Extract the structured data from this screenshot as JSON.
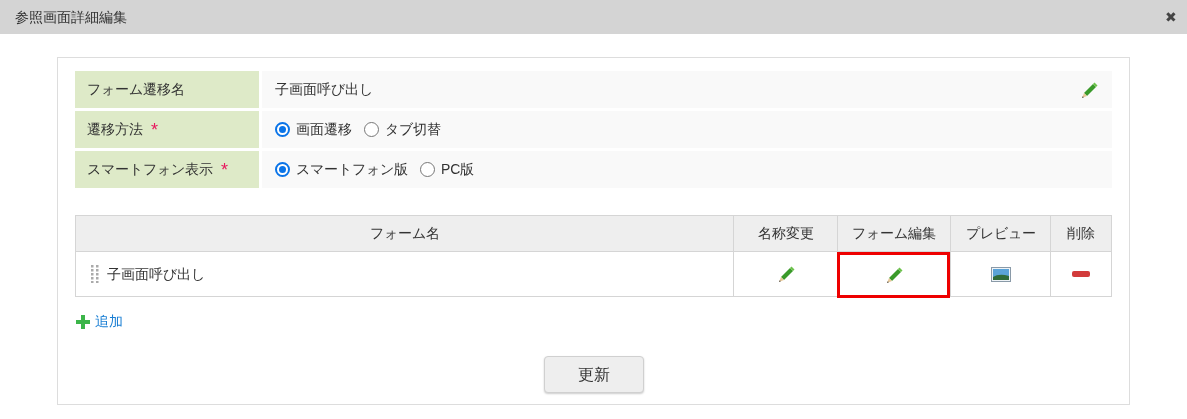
{
  "window": {
    "title": "参照画面詳細編集",
    "close": "✖"
  },
  "form": [
    {
      "kind": "text",
      "label": "フォーム遷移名",
      "required": false,
      "value": "子画面呼び出し"
    },
    {
      "kind": "radio",
      "label": "遷移方法",
      "required": true,
      "options": [
        {
          "label": "画面遷移",
          "selected": true
        },
        {
          "label": "タブ切替",
          "selected": false
        }
      ]
    },
    {
      "kind": "radio",
      "label": "スマートフォン表示",
      "required": true,
      "options": [
        {
          "label": "スマートフォン版",
          "selected": true
        },
        {
          "label": "PC版",
          "selected": false
        }
      ]
    }
  ],
  "required_mark": "*",
  "table": {
    "columns": [
      "フォーム名",
      "名称変更",
      "フォーム編集",
      "プレビュー",
      "削除"
    ],
    "rows": [
      {
        "name": "子画面呼び出し",
        "actions": [
          {
            "kind": "edit",
            "highlighted": false
          },
          {
            "kind": "edit",
            "highlighted": true
          },
          {
            "kind": "preview",
            "highlighted": false
          },
          {
            "kind": "delete",
            "highlighted": false
          }
        ]
      }
    ]
  },
  "add_link": "追加",
  "submit_button": "更新"
}
